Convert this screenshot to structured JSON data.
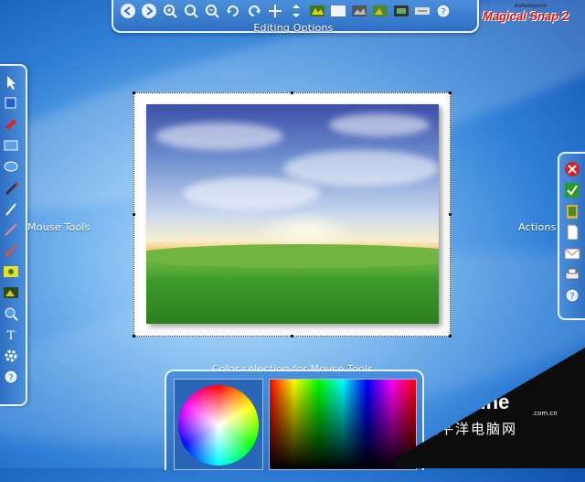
{
  "top_toolbar": {
    "title": "Editing Options",
    "icons": [
      "back-icon",
      "forward-icon",
      "zoom-in-icon",
      "zoom-reset-icon",
      "zoom-out-icon",
      "rotate-left-icon",
      "rotate-right-icon",
      "move-icon",
      "resize-icon",
      "effects-icon",
      "blank-icon",
      "filter-icon",
      "photo-icon",
      "film-icon",
      "text-label-icon",
      "help-icon"
    ]
  },
  "logo": {
    "small": "Ashampoo®",
    "main": "Magical Snap 2"
  },
  "left_panel": {
    "title": "Mouse Tools",
    "icons": [
      "select-icon",
      "rectangle-select-icon",
      "marker-icon",
      "rectangle-icon",
      "ellipse-icon",
      "pen-icon",
      "brush-icon",
      "line-icon",
      "arrow-icon",
      "highlight-icon",
      "image-icon",
      "zoom-tool-icon",
      "text-tool-icon",
      "settings-icon",
      "help-icon"
    ]
  },
  "right_panel": {
    "title": "Actions",
    "icons": [
      "close-icon",
      "accept-icon",
      "clipboard-icon",
      "document-icon",
      "email-icon",
      "print-icon",
      "help-icon"
    ]
  },
  "color_panel": {
    "title": "Color selection for Mouse Tools"
  },
  "watermark": {
    "brand": "PConline",
    "domain": ".com.cn",
    "subtitle": "太平洋电脑网"
  }
}
